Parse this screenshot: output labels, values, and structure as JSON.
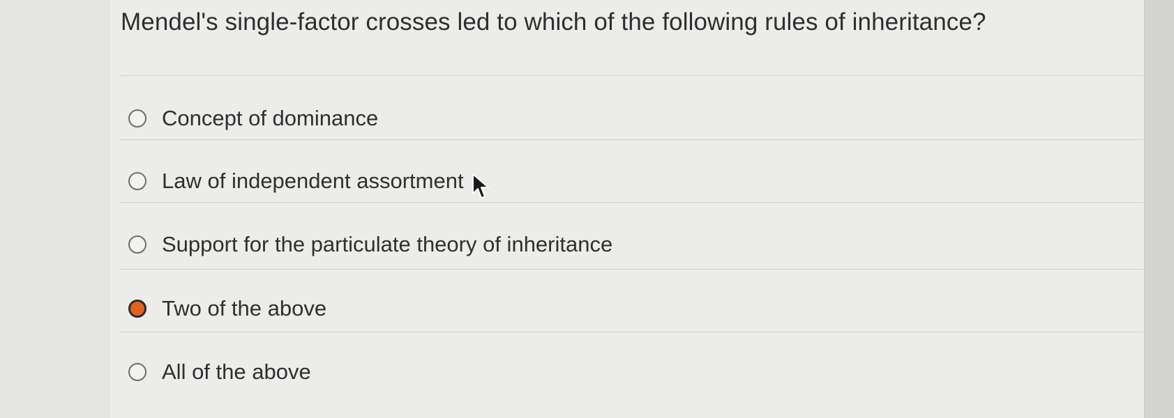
{
  "question": {
    "text": "Mendel's single-factor crosses led to which of the following rules of inheritance?"
  },
  "options": [
    {
      "label": "Concept of dominance",
      "selected": false
    },
    {
      "label": "Law of independent assortment",
      "selected": false
    },
    {
      "label": "Support for the particulate theory of inheritance",
      "selected": false
    },
    {
      "label": "Two of the above",
      "selected": true
    },
    {
      "label": "All of the above",
      "selected": false
    }
  ],
  "colors": {
    "selected_radio": "#e2621d",
    "background": "#ececea"
  },
  "icons": {
    "pointer": "mouse-pointer-icon"
  }
}
